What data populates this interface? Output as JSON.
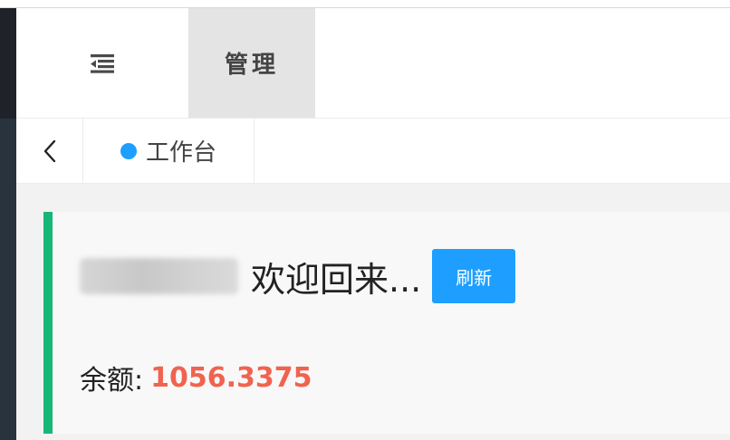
{
  "header": {
    "menu_toggle_icon": "menu-fold-icon",
    "nav_item": "管理"
  },
  "tabs": {
    "back_icon": "chevron-left-icon",
    "home_label": "工作台",
    "home_dot_color": "#1e9fff"
  },
  "welcome": {
    "message": "欢迎回来...",
    "refresh_label": "刷新"
  },
  "balance": {
    "label": "余额:",
    "value": "1056.3375"
  },
  "colors": {
    "accent": "#1e9fff",
    "card_border": "#16b777",
    "balance": "#f0634f",
    "sidebar": "#28333e"
  }
}
